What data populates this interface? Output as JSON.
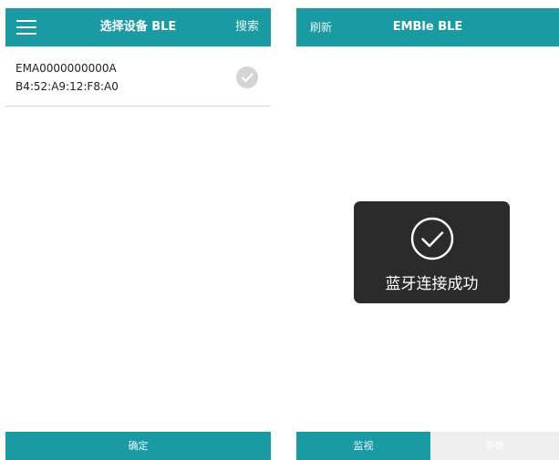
{
  "left_screen": {
    "header": {
      "title": "选择设备 BLE",
      "menu_icon": "menu-icon",
      "search_label": "搜索"
    },
    "devices": [
      {
        "name": "EMA0000000000A",
        "mac": "B4:52:A9:12:F8:A0",
        "status_icon": "check-circle-icon"
      }
    ],
    "footer": {
      "confirm_label": "确定"
    }
  },
  "right_screen": {
    "header": {
      "title": "EMBle BLE",
      "refresh_label": "刷新"
    },
    "toast": {
      "icon": "check-circle-icon",
      "message": "蓝牙连接成功"
    },
    "tabs": [
      {
        "label": "监视",
        "active": true
      },
      {
        "label": "参数",
        "active": false
      }
    ]
  },
  "colors": {
    "primary": "#1a9aa3",
    "toast_bg": "#2b2b2b",
    "inactive_tab_bg": "#eeeeee",
    "check_gray": "#d4d4d4"
  }
}
